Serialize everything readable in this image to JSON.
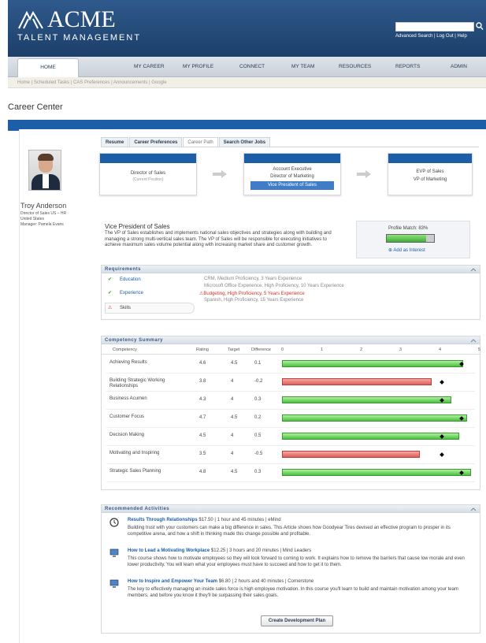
{
  "app": {
    "brand": "ACME",
    "brand_sub": "TALENT MANAGEMENT",
    "util_links": "Advanced Search | Log Out | Help"
  },
  "nav": {
    "home": "HOME",
    "items": [
      "MY CAREER",
      "MY PROFILE",
      "CONNECT",
      "MY TEAM",
      "RESOURCES",
      "REPORTS",
      "ADMIN"
    ]
  },
  "subnav": "Home | Scheduled Tasks | CAS Preferences | Announcements | Google",
  "page_title": "Career Center",
  "profile": {
    "name": "Troy Anderson",
    "lines": [
      "Director of Sales US – HR",
      "United States",
      "Manager: Pamela Evans"
    ]
  },
  "tabs": [
    "Resume",
    "Career Preferences",
    "Career Path",
    "Search Other Jobs"
  ],
  "path": {
    "current": {
      "title": "Director of Sales",
      "note": "(Current Position)"
    },
    "middle": {
      "options": [
        "Account Executive",
        "Director of Marketing"
      ],
      "selected": "Vice President of Sales"
    },
    "next": {
      "options": [
        "EVP of Sales",
        "VP of Marketing"
      ]
    }
  },
  "role": {
    "title": "Vice President of Sales",
    "description": "The VP of Sales establishes and implements national sales objectives and strategies along with building and managing a strong multi-vertical sales team. The VP of Sales will be responsible for executing initiatives to achieve maximum sales volume potential along with increasing market share and customer growth.",
    "profile_match_label": "Profile Match: 83%",
    "profile_match": 0.83,
    "add_interest": "Add as Interest"
  },
  "requirements": {
    "title": "Requirements",
    "items": [
      {
        "label": "Education",
        "status": "met"
      },
      {
        "label": "Experience",
        "status": "met"
      },
      {
        "label": "Skills",
        "status": "warning"
      }
    ],
    "details": [
      {
        "text": "CRM, Medium Proficiency, 3 Years Experience",
        "warn": false
      },
      {
        "text": "Microsoft Office Experience, High Proficiency, 10 Years Experience",
        "warn": false
      },
      {
        "text": "Budgeting, High Proficiency, 5 Years Experience",
        "warn": true
      },
      {
        "text": "Spanish, High Proficiency, 15 Years Experience",
        "warn": false
      }
    ]
  },
  "competency": {
    "title": "Competency Summary",
    "headers": {
      "competency": "Competency",
      "rating": "Rating",
      "target": "Target",
      "difference": "Difference"
    },
    "scale": [
      "0",
      "1",
      "2",
      "3",
      "4",
      "5"
    ],
    "rows": [
      {
        "name": "Achieving Results",
        "rating": "4.6",
        "target": "4.5",
        "difference": "0.1",
        "r": 4.6,
        "t": 4.5
      },
      {
        "name": "Building Strategic Working Relationships",
        "rating": "3.8",
        "target": "4",
        "difference": "-0.2",
        "r": 3.8,
        "t": 4
      },
      {
        "name": "Business Acumen",
        "rating": "4.3",
        "target": "4",
        "difference": "0.3",
        "r": 4.3,
        "t": 4
      },
      {
        "name": "Customer Focus",
        "rating": "4.7",
        "target": "4.5",
        "difference": "0.2",
        "r": 4.7,
        "t": 4.5
      },
      {
        "name": "Decision Making",
        "rating": "4.5",
        "target": "4",
        "difference": "0.5",
        "r": 4.5,
        "t": 4
      },
      {
        "name": "Motivating and Inspiring",
        "rating": "3.5",
        "target": "4",
        "difference": "-0.5",
        "r": 3.5,
        "t": 4
      },
      {
        "name": "Strategic Sales Planning",
        "rating": "4.8",
        "target": "4.5",
        "difference": "0.3",
        "r": 4.8,
        "t": 4.5
      }
    ]
  },
  "activities": {
    "title": "Recommended Activities",
    "items": [
      {
        "title": "Results Through Relationships",
        "meta": "$17.50 | 1 hour and 45 minutes | eMind",
        "text": "Building trust with your customers can make a big difference in sales. This Article shows how Goodyear Tires devised an effective program to prosper in its competitive arena, and how a shift in thinking made this change possible and profitable."
      },
      {
        "title": "How to Lead a Motivating Workplace",
        "meta": "$12.25 | 3 hours and 20 minutes | Mind Leaders",
        "text": "This course shows how to motivate employees so they will look forward to coming to work. It explains how to remove the barriers that cause low morale and even lower productivity. You will learn what your employees must have to succeed and how to get it to them."
      },
      {
        "title": "How to Inspire and Empower Your Team",
        "meta": "$6.80 | 2 hours and 40 minutes | Cornerstone",
        "text": "The key to effectively managing an inside sales force is high employee motivation. In this course you'll learn to build and maintain motivation among your team members, and before you know it they'll be surpassing their sales goals."
      }
    ],
    "button": "Create Development Plan"
  }
}
